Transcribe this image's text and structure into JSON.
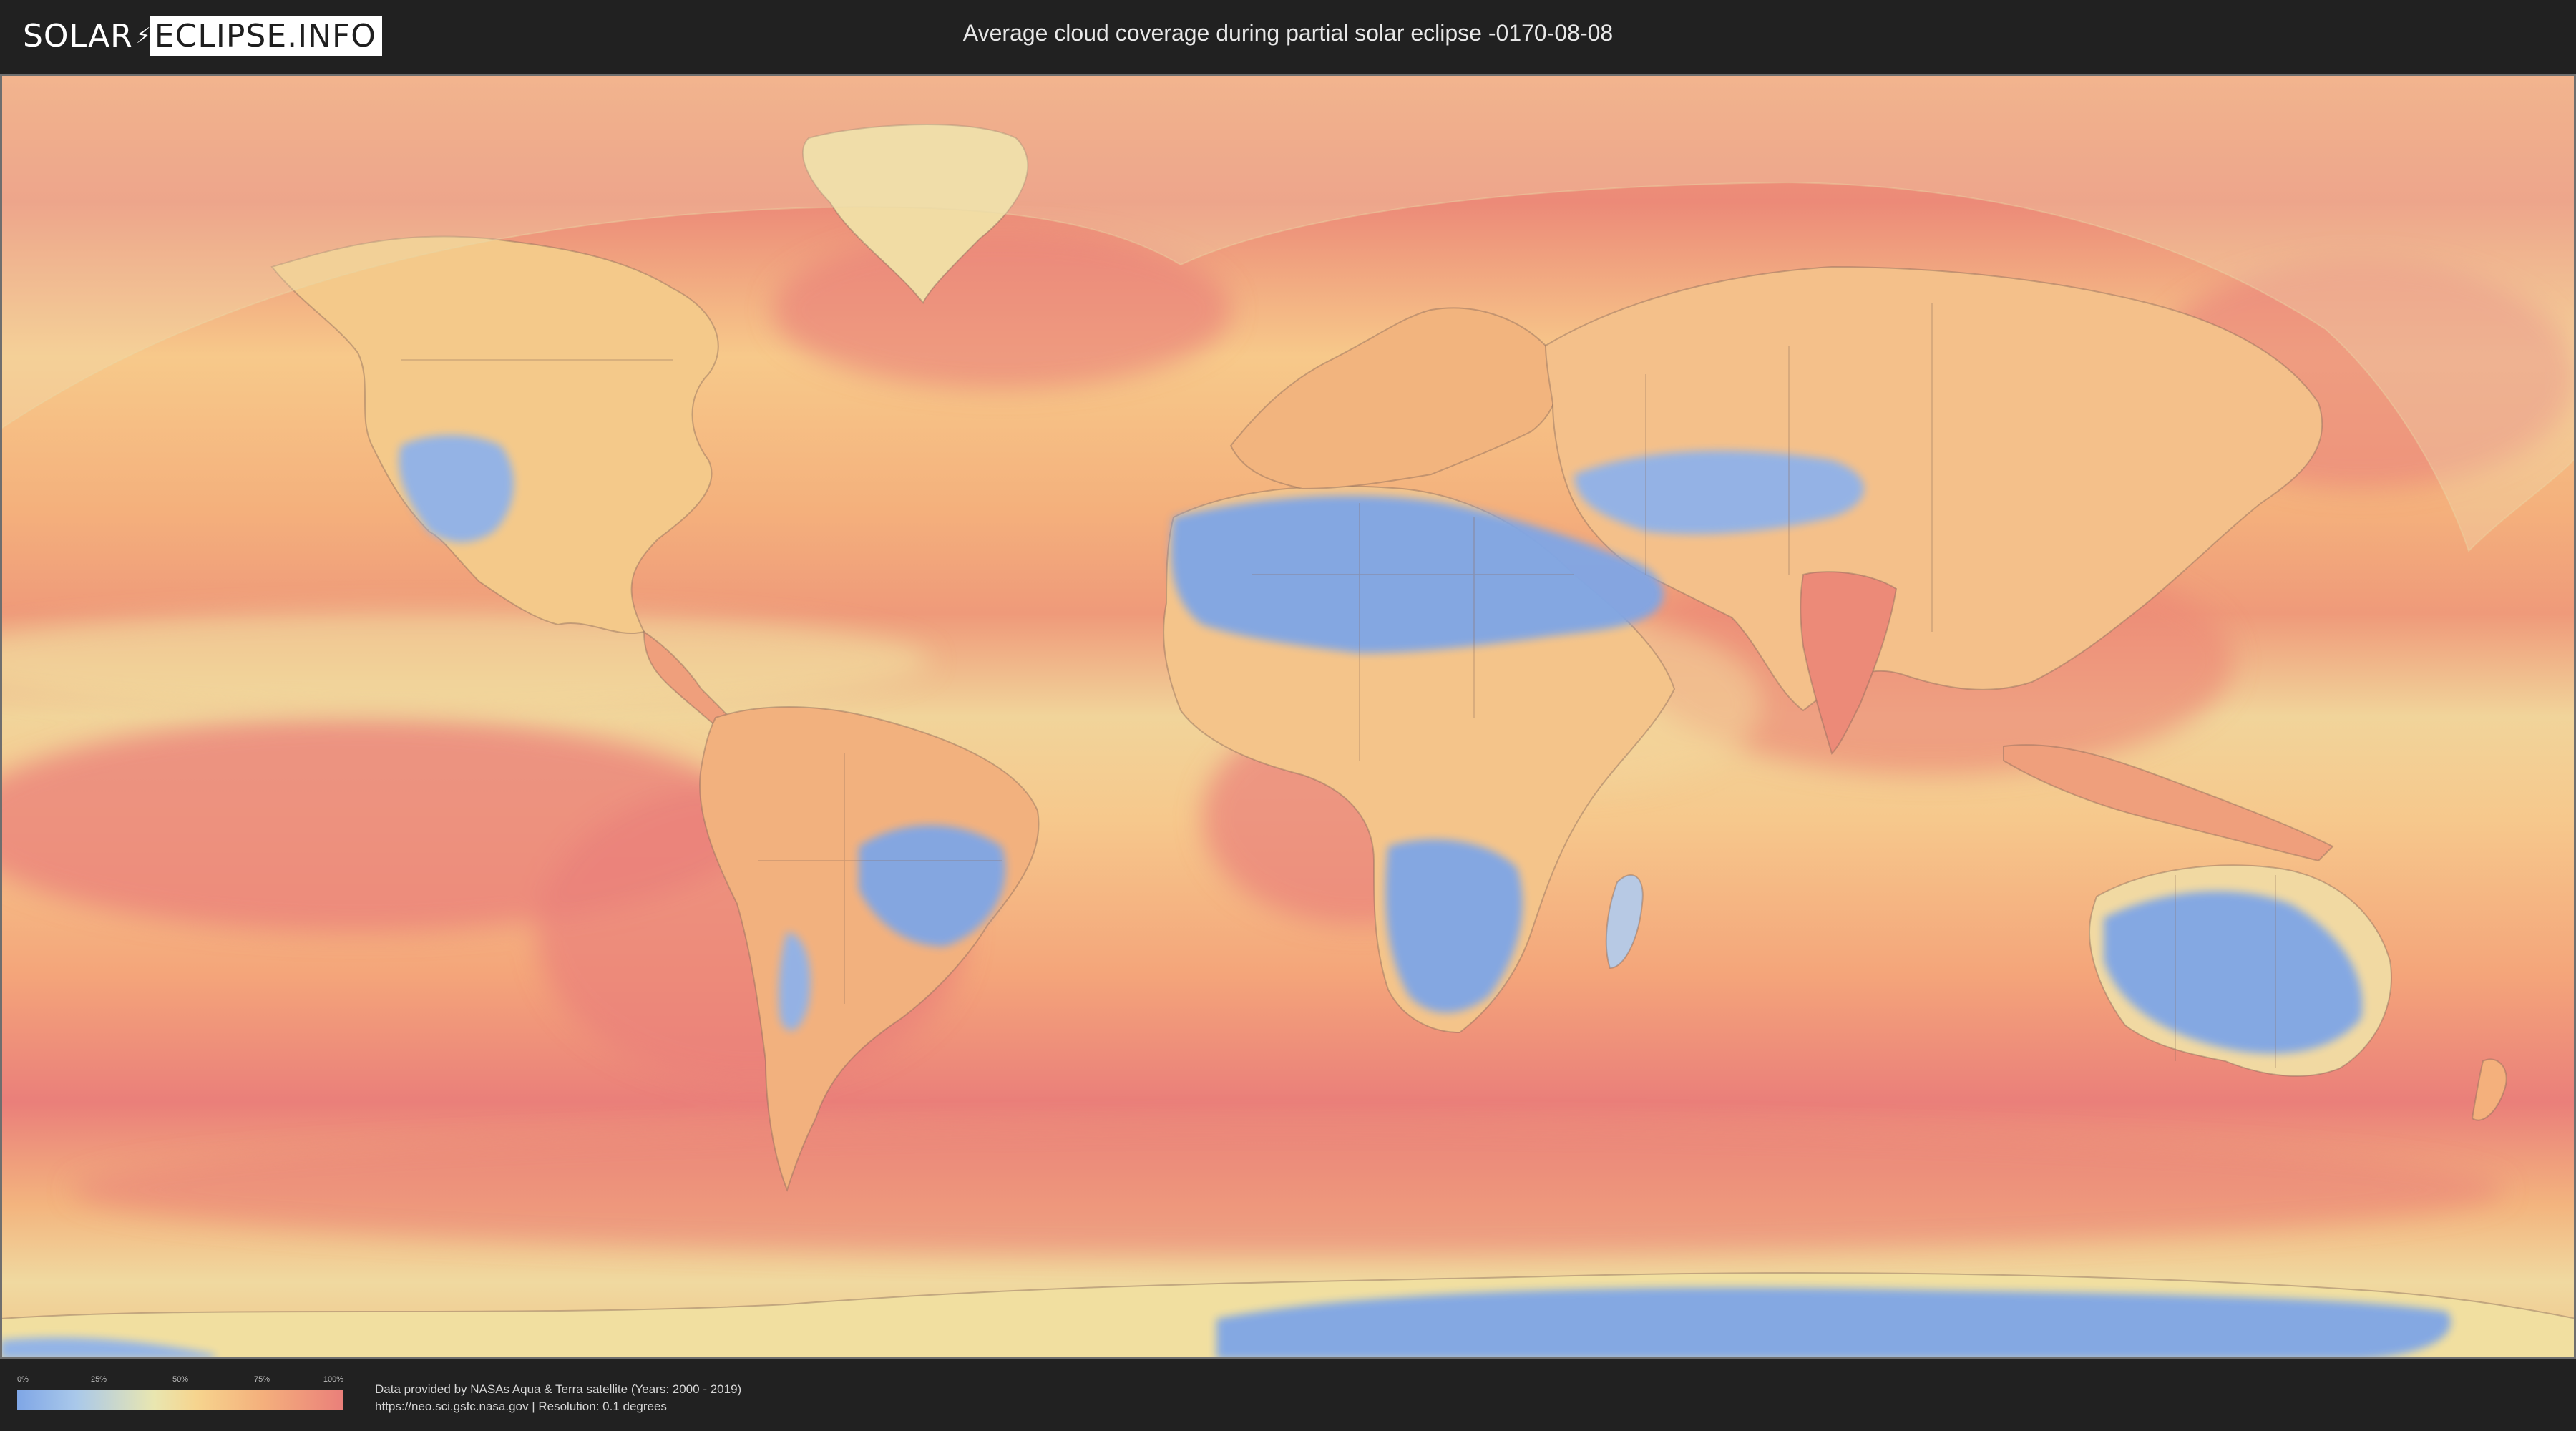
{
  "header": {
    "logo": {
      "part1": "SOLAR",
      "part2": "ECLIPSE.INFO"
    },
    "title": "Average cloud coverage during partial solar eclipse -0170-08-08"
  },
  "map": {
    "type": "world cloud coverage map",
    "colors": {
      "clear": "#7fa6e6",
      "low": "#a9c8ea",
      "mid": "#f1dfa0",
      "high": "#f4b07c",
      "overcast": "#ea7f7a",
      "eclipse_overlay": "#efe0b4",
      "border": "#8a6a5a"
    }
  },
  "legend": {
    "ticks": [
      "0%",
      "25%",
      "50%",
      "75%",
      "100%"
    ],
    "gradient": [
      "#7fa6e6",
      "#a9c8ea",
      "#e9e6b0",
      "#f6d48e",
      "#f4b07c",
      "#ea7f7a"
    ]
  },
  "footer": {
    "credit_line1": "Data provided by NASAs Aqua & Terra satellite (Years: 2000 - 2019)",
    "credit_line2": "https://neo.sci.gsfc.nasa.gov | Resolution: 0.1 degrees"
  }
}
